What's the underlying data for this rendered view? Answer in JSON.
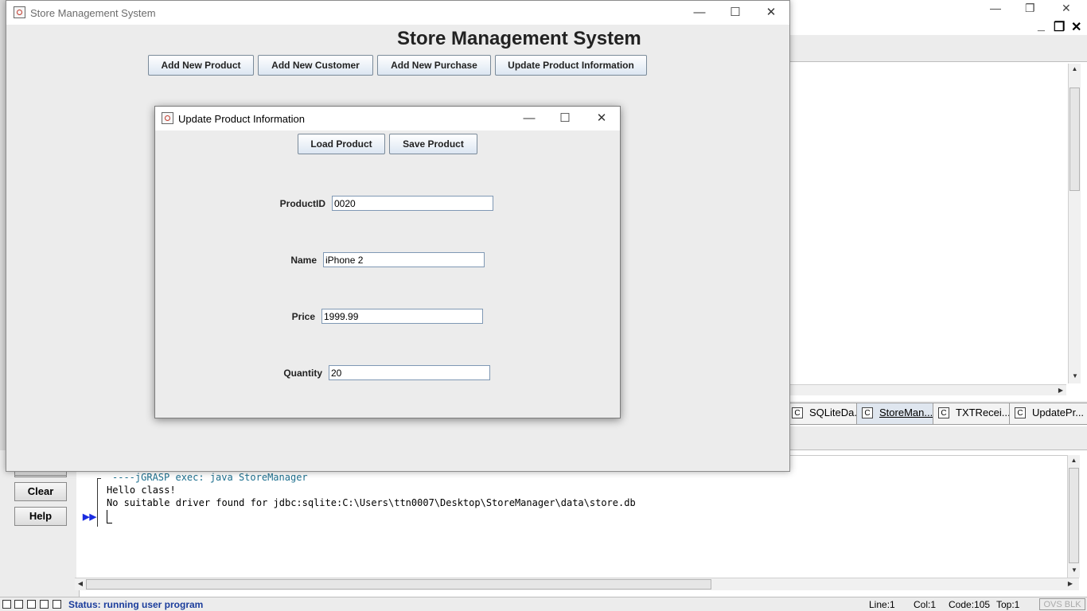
{
  "store_window": {
    "title": "Store Management System",
    "heading": "Store Management System",
    "buttons": {
      "add_product": "Add New Product",
      "add_customer": "Add New Customer",
      "add_purchase": "Add New Purchase",
      "update_product": "Update Product Information"
    }
  },
  "update_dialog": {
    "title": "Update Product Information",
    "load_button": "Load Product",
    "save_button": "Save Product",
    "fields": {
      "product_id": {
        "label": "ProductID",
        "value": "0020"
      },
      "name": {
        "label": "Name",
        "value": "iPhone 2"
      },
      "price": {
        "label": "Price",
        "value": "1999.99"
      },
      "quantity": {
        "label": "Quantity",
        "value": "20"
      }
    }
  },
  "ide": {
    "doc_tabs": [
      "SQLiteDa...",
      "StoreMan...",
      "TXTRecei...",
      "UpdatePr..."
    ],
    "side_buttons": {
      "clear": "Clear",
      "help": "Help"
    },
    "messages": {
      "exec": "----jGRASP exec: java StoreManager",
      "line1": "Hello class!",
      "line2": "No suitable driver found for jdbc:sqlite:C:\\Users\\ttn0007\\Desktop\\StoreManager\\data\\store.db"
    },
    "status": {
      "text": "Status: running user program",
      "line": "Line:1",
      "col": "Col:1",
      "code": "Code:105",
      "top": "Top:1",
      "mode": "OVS BLK"
    }
  },
  "colors": {
    "status_text": "#1b3d9c",
    "exec_text": "#1d6f8e",
    "run_arrow": "#1a2ce0"
  }
}
